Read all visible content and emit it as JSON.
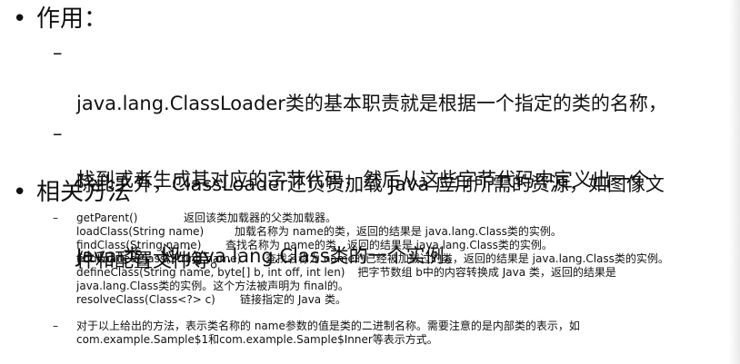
{
  "section1": {
    "bullet": "•",
    "title": "作用：",
    "items": [
      {
        "mark": "–",
        "lines": [
          "java.lang.ClassLoader类的基本职责就是根据一个指定的类的名称，",
          "找到或者生成其对应的字节代码，然后从这些字节代码中定义出一个",
          "Java 类，即 java.lang.Class类的一个实例。"
        ]
      },
      {
        "mark": "–",
        "lines": [
          "除此之外，ClassLoader还负责加载 Java 应用所需的资源，如图像文",
          "件和配置文件等。"
        ]
      }
    ]
  },
  "section2": {
    "bullet": "•",
    "title": "相关方法",
    "methods_mark": "–",
    "methods": [
      {
        "sig": "getParent()",
        "desc": "返回该类加载器的父类加载器。"
      },
      {
        "sig": "loadClass(String name)",
        "desc": "加载名称为 name的类，返回的结果是 java.lang.Class类的实例。"
      },
      {
        "sig": "findClass(String name)",
        "desc": "查找名称为 name的类，返回的结果是 java.lang.Class类的实例。"
      },
      {
        "sig": "findLoadedClass(String name)",
        "desc": "查找名称为 name的已经被加载过的类，返回的结果是 java.lang.Class类的实例。"
      },
      {
        "sig": "defineClass(String name, byte[] b, int off, int len)",
        "desc": "把字节数组 b中的内容转换成 Java 类，返回的结果是"
      },
      {
        "sig": "java.lang.Class类的实例。这个方法被声明为 final的。",
        "desc": ""
      },
      {
        "sig": "resolveClass(Class<?> c)",
        "desc": "链接指定的 Java 类。"
      }
    ],
    "note_mark": "–",
    "note_lines": [
      "对于以上给出的方法，表示类名称的 name参数的值是类的二进制名称。需要注意的是内部类的表示，如",
      "com.example.Sample$1和com.example.Sample$Inner等表示方式。"
    ]
  }
}
